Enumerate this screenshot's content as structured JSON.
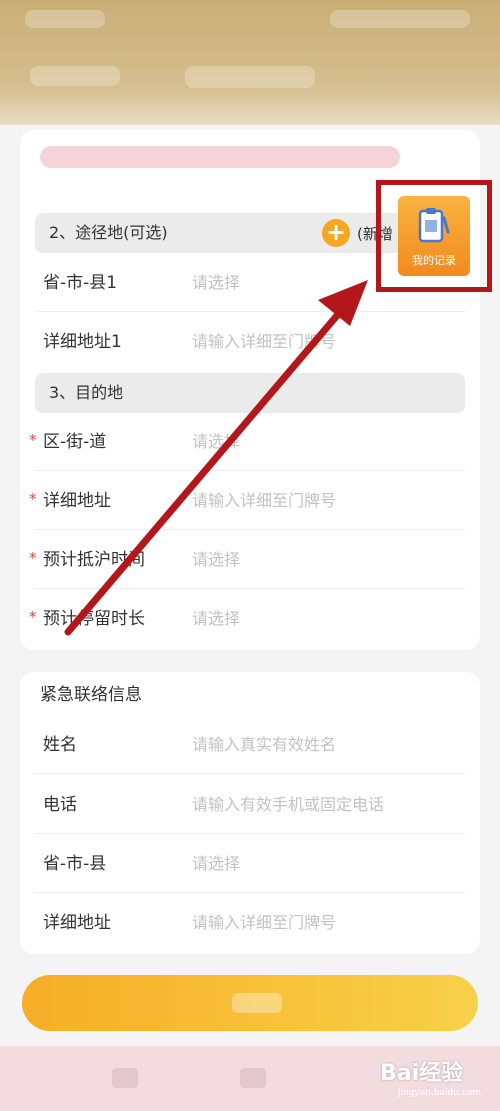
{
  "route": {
    "section_title": "2、途径地(可选)",
    "add_label": "(新增",
    "rows": [
      {
        "label": "省-市-县1",
        "value": "请选择"
      },
      {
        "label": "详细地址1",
        "value": "请输入详细至门牌号"
      }
    ]
  },
  "destination": {
    "section_title": "3、目的地",
    "rows": [
      {
        "label": "区-街-道",
        "value": "请选择"
      },
      {
        "label": "详细地址",
        "value": "请输入详细至门牌号"
      },
      {
        "label": "预计抵沪时间",
        "value": "请选择"
      },
      {
        "label": "预计停留时长",
        "value": "请选择"
      }
    ],
    "required_mark": "*"
  },
  "emergency": {
    "title": "紧急联络信息",
    "rows": [
      {
        "label": "姓名",
        "value": "请输入真实有效姓名"
      },
      {
        "label": "电话",
        "value": "请输入有效手机或固定电话"
      },
      {
        "label": "省-市-县",
        "value": "请选择"
      },
      {
        "label": "详细地址",
        "value": "请输入详细至门牌号"
      }
    ]
  },
  "my_record": {
    "label": "我的记录"
  },
  "watermark": {
    "text": "Bai经验",
    "sub": "jingyan.baidu.com"
  },
  "colors": {
    "accent": "#f5a623",
    "highlight": "#b4171b",
    "required": "#e0463c"
  }
}
